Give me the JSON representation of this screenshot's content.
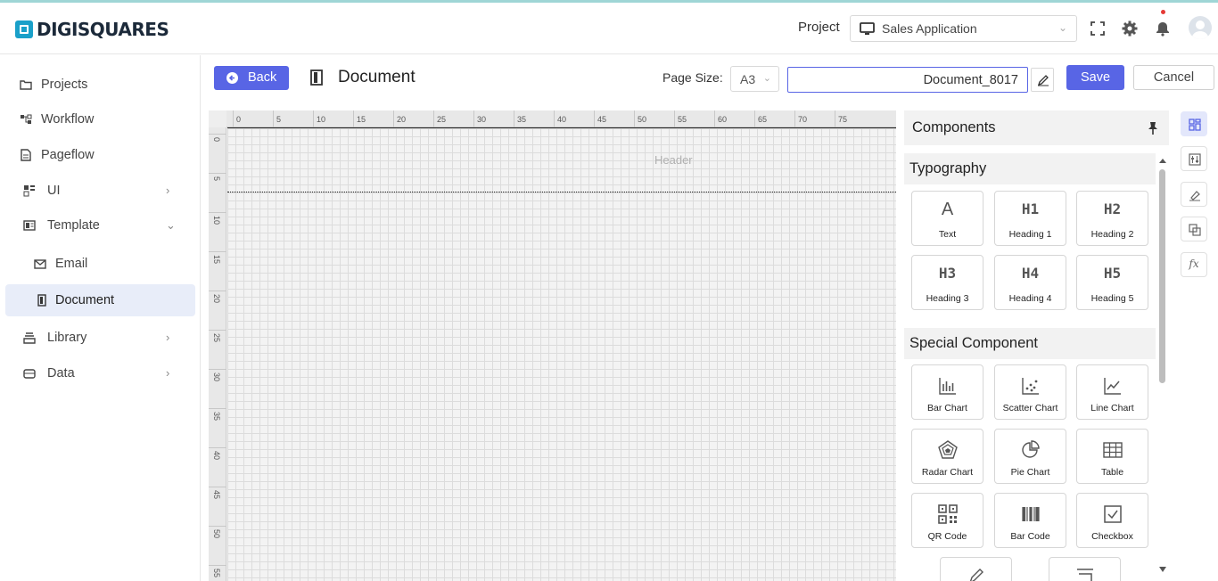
{
  "app": {
    "brand": "DIGISQUARES"
  },
  "header": {
    "project_label": "Project",
    "project_value": "Sales Application",
    "icons": [
      "monitor-icon",
      "chevron-down-icon",
      "fullscreen-icon",
      "gear-icon",
      "bell-icon",
      "avatar"
    ]
  },
  "sidebar": {
    "items": [
      {
        "label": "Projects",
        "icon": "folder-icon"
      },
      {
        "label": "Workflow",
        "icon": "workflow-icon"
      },
      {
        "label": "Pageflow",
        "icon": "page-icon"
      },
      {
        "label": "UI",
        "icon": "ui-icon",
        "arrow": "›"
      },
      {
        "label": "Template",
        "icon": "template-icon",
        "arrow": "⌄"
      },
      {
        "label": "Email",
        "icon": "mail-icon"
      },
      {
        "label": "Document",
        "icon": "document-icon",
        "active": true
      },
      {
        "label": "Library",
        "icon": "library-icon",
        "arrow": "›"
      },
      {
        "label": "Data",
        "icon": "data-icon",
        "arrow": "›"
      }
    ]
  },
  "toolbar": {
    "back_label": "Back",
    "title": "Document",
    "page_size_label": "Page Size:",
    "page_size_value": "A3",
    "document_name": "Document_8017",
    "save_label": "Save",
    "cancel_label": "Cancel"
  },
  "canvas": {
    "ruler_top": [
      "0",
      "5",
      "10",
      "15",
      "20",
      "25",
      "30",
      "35",
      "40",
      "45",
      "50",
      "55",
      "60",
      "65",
      "70",
      "75"
    ],
    "ruler_left": [
      "0",
      "5",
      "10",
      "15",
      "20",
      "25",
      "30",
      "35",
      "40",
      "45",
      "50",
      "55"
    ],
    "header_label": "Header"
  },
  "components": {
    "title": "Components",
    "typography": {
      "title": "Typography",
      "items": [
        {
          "glyph": "A",
          "label": "Text"
        },
        {
          "glyph": "H1",
          "label": "Heading 1"
        },
        {
          "glyph": "H2",
          "label": "Heading 2"
        },
        {
          "glyph": "H3",
          "label": "Heading 3"
        },
        {
          "glyph": "H4",
          "label": "Heading 4"
        },
        {
          "glyph": "H5",
          "label": "Heading 5"
        }
      ]
    },
    "special": {
      "title": "Special Component",
      "items": [
        {
          "icon": "bar-chart-icon",
          "label": "Bar Chart"
        },
        {
          "icon": "scatter-chart-icon",
          "label": "Scatter Chart"
        },
        {
          "icon": "line-chart-icon",
          "label": "Line Chart"
        },
        {
          "icon": "radar-chart-icon",
          "label": "Radar Chart"
        },
        {
          "icon": "pie-chart-icon",
          "label": "Pie Chart"
        },
        {
          "icon": "table-icon",
          "label": "Table"
        },
        {
          "icon": "qr-code-icon",
          "label": "QR Code"
        },
        {
          "icon": "barcode-icon",
          "label": "Bar Code"
        },
        {
          "icon": "checkbox-icon",
          "label": "Checkbox"
        }
      ]
    }
  },
  "right_toolbar": {
    "items": [
      "components-icon",
      "properties-icon",
      "style-icon",
      "layers-icon",
      "function-icon"
    ],
    "fx_label": "fx"
  },
  "colors": {
    "primary": "#5865e5",
    "brand": "#1aa0c9",
    "active_bg": "#e8edf9"
  }
}
